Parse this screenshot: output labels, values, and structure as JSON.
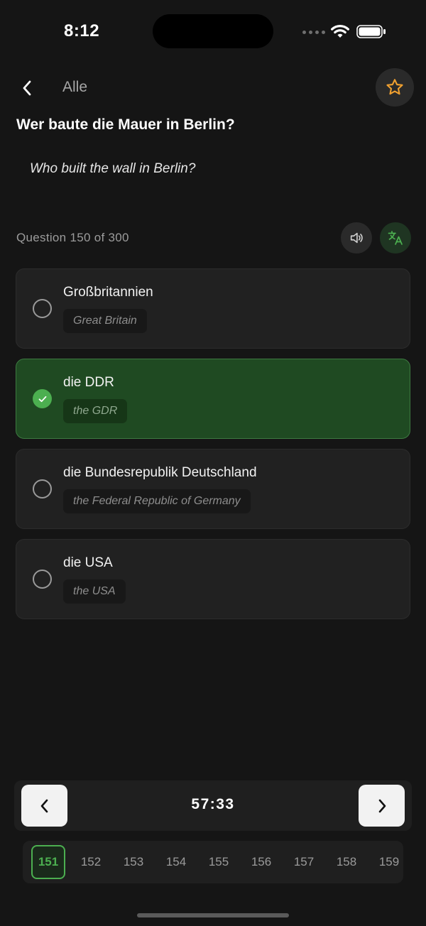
{
  "status_bar": {
    "time": "8:12"
  },
  "header": {
    "back_label": "Alle"
  },
  "question": {
    "text": "Wer baute die Mauer in Berlin?",
    "translation": "Who built the wall in Berlin?",
    "counter": "Question 150 of 300"
  },
  "answers": [
    {
      "text": "Großbritannien",
      "translation": "Great Britain",
      "selected": false
    },
    {
      "text": "die DDR",
      "translation": "the GDR",
      "selected": true
    },
    {
      "text": "die Bundesrepublik Deutschland",
      "translation": "the Federal Republic of Germany",
      "selected": false
    },
    {
      "text": "die USA",
      "translation": "the USA",
      "selected": false
    }
  ],
  "navigation": {
    "timer": "57:33"
  },
  "pager": {
    "pages": [
      "151",
      "152",
      "153",
      "154",
      "155",
      "156",
      "157",
      "158",
      "159"
    ],
    "active": "151"
  },
  "colors": {
    "accent": "#4caf50",
    "star": "#f0a030",
    "selected_bg": "#1f4a22"
  },
  "icons": [
    "back-chevron-icon",
    "star-icon",
    "speaker-icon",
    "translate-icon",
    "check-icon",
    "chevron-left-icon",
    "chevron-right-icon"
  ]
}
